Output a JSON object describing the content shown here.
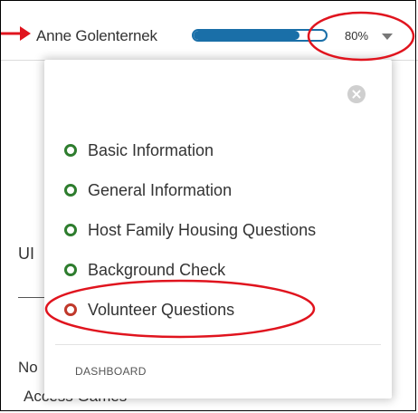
{
  "header": {
    "user_name": "Anne Golenternek",
    "progress_percent": 80,
    "progress_label": "80%"
  },
  "background": {
    "heading_fragment": "UI",
    "row1_fragment": "No",
    "row2_fragment": "Access Games"
  },
  "dropdown": {
    "steps": [
      {
        "label": "Basic Information",
        "status": "complete"
      },
      {
        "label": "General Information",
        "status": "complete"
      },
      {
        "label": "Host Family Housing Questions",
        "status": "complete"
      },
      {
        "label": "Background Check",
        "status": "complete"
      },
      {
        "label": "Volunteer Questions",
        "status": "incomplete"
      }
    ],
    "footer_link": "DASHBOARD"
  },
  "colors": {
    "progress": "#1a6fa8",
    "complete_dot": "#2e7d2e",
    "incomplete_dot": "#c0392b",
    "annotation": "#e0141e"
  },
  "icons": [
    "pointer-arrow-icon",
    "chevron-down-icon",
    "close-icon"
  ]
}
